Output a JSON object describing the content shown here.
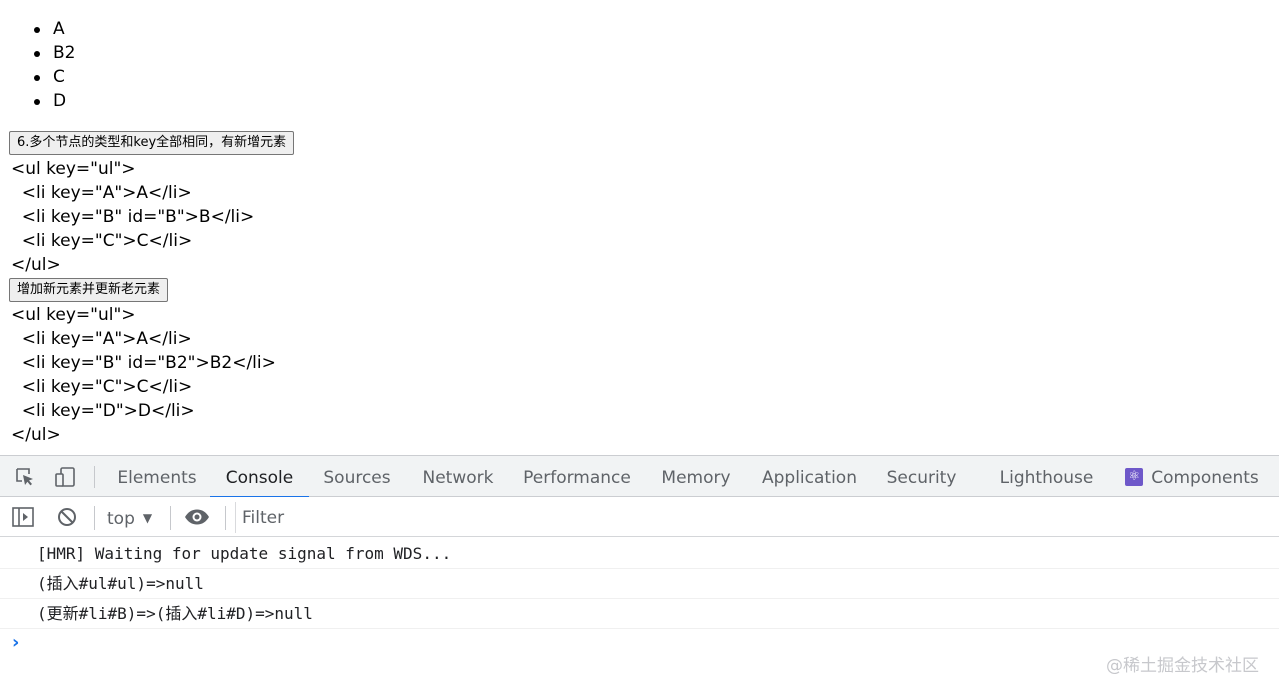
{
  "page": {
    "list_items": [
      "A",
      "B2",
      "C",
      "D"
    ],
    "button1_label": "6.多个节点的类型和key全部相同，有新增元素",
    "code_block1": [
      "<ul key=\"ul\">",
      "  <li key=\"A\">A</li>",
      "  <li key=\"B\" id=\"B\">B</li>",
      "  <li key=\"C\">C</li>",
      "</ul>"
    ],
    "button2_label": "增加新元素并更新老元素",
    "code_block2": [
      "<ul key=\"ul\">",
      "  <li key=\"A\">A</li>",
      "  <li key=\"B\" id=\"B2\">B2</li>",
      "  <li key=\"C\">C</li>",
      "  <li key=\"D\">D</li>",
      "</ul>"
    ]
  },
  "devtools": {
    "tabs": [
      "Elements",
      "Console",
      "Sources",
      "Network",
      "Performance",
      "Memory",
      "Application",
      "Security",
      "Lighthouse",
      "Components"
    ],
    "active_tab": "Console",
    "toolbar": {
      "context": "top",
      "filter_placeholder": "Filter"
    },
    "console_messages": [
      "[HMR] Waiting for update signal from WDS...",
      "(插入#ul#ul)=>null",
      "(更新#li#B)=>(插入#li#D)=>null"
    ],
    "prompt": "›",
    "colors": {
      "accent": "#1a73e8",
      "components_icon": "#6e58c9"
    }
  },
  "watermark": "@稀土掘金技术社区"
}
